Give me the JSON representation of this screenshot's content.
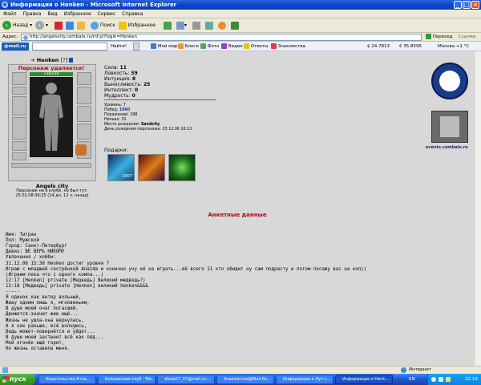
{
  "window": {
    "title": "Информация о Henken - Microsoft Internet Explorer"
  },
  "menu": [
    "Файл",
    "Правка",
    "Вид",
    "Избранное",
    "Сервис",
    "Справка"
  ],
  "toolbar": {
    "back": "Назад",
    "search": "Поиск",
    "favorites": "Избранное"
  },
  "address": {
    "label": "Адрес:",
    "url": "http://angelscity.combats.ru/inf.pl?login=Henken",
    "go": "Переход",
    "links": "Ссылки"
  },
  "mailbar": {
    "brand": "@mail.ru",
    "search_placeholder": "",
    "find": "Найти!",
    "items": [
      "Мой мир",
      "Блоги",
      "Фото",
      "Видео",
      "Ответы",
      "Знакомства"
    ],
    "usd": "$ 24.7813",
    "eur": "€ 35.8595",
    "weather": "Москва +1 °C"
  },
  "char": {
    "name": "Henken",
    "level": "[?]",
    "status": "Персонаж удаляется!",
    "hp": "238/238",
    "city": "Angels city",
    "presence": "Персонаж не в клубе, но был тут:",
    "last_seen": "25.01.08 09:25 (14 дн. 12 ч. назад)",
    "stats": [
      {
        "label": "Сила:",
        "value": "11"
      },
      {
        "label": "Ловкость:",
        "value": "39"
      },
      {
        "label": "Интуиция:",
        "value": "8"
      },
      {
        "label": "Выносливость:",
        "value": "25"
      },
      {
        "label": "Интеллект:",
        "value": "0"
      },
      {
        "label": "Мудрость:",
        "value": "0"
      }
    ],
    "info": [
      {
        "label": "Уровень:",
        "value": "7"
      },
      {
        "label": "Побед:",
        "value": "1060"
      },
      {
        "label": "Поражений:",
        "value": "298"
      },
      {
        "label": "Ничьих:",
        "value": "32"
      },
      {
        "label": "Место рождения:",
        "value": "Sandcity"
      },
      {
        "label": "День рождения персонажа:",
        "value": "03.12.06 16:13"
      }
    ],
    "gifts_label": "Подарки:",
    "gift_text": "2007"
  },
  "events": {
    "link": "events.combats.ru"
  },
  "section_title": "Анкетные данные",
  "profile_lines": [
    "Имя: Тигран",
    "Пол: Мужской",
    "Город: Санкт-Петербург",
    "Девиз: ВЕ ВЕРЬ НИКОМУ",
    "Увлечения / хобби:",
    "31.12.06 15:38 Henken достиг уровня 7",
    "",
    "Играю с младшей сестрёнкой Anaida и конечно учу её ка играть...её всего 11 кто обидит ну сам подрасту и потом посажу вас на кол))",
    "(Играем пока что с одного компа...)",
    "",
    "12:17 [Henken] private [Медведь] Великий медведь?)",
    "12:18 [Медведь] private [Henken] великий henken&&&&",
    "-----",
    "Я одинок как ветер вольный,",
    "Живу одним лишь я, мгновеньем,",
    "В душе моей очаг погасший,",
    "Движется-значит жив ещё...",
    "Жизнь не ушла-она вернулась,",
    "А я как раньше, всё волнуюсь,",
    "Ведь может-повернётся и уйдет...",
    "В душе моей застынет всё как лёд...",
    "Мой огонёк ещё горит,",
    "Но жизнь оставила меня."
  ],
  "status": {
    "zone": "Интернет"
  },
  "taskbar": {
    "start": "пуск",
    "tasks": [
      "Издательство Атла...",
      "Бойцовский клуб - Ми...",
      "diana27_07@mail.ru:...",
      "Знакомства@Mail.Ru...",
      "Информация о Луч с...",
      "Информация о Henk..."
    ],
    "lang": "EN",
    "time": "22:19"
  }
}
